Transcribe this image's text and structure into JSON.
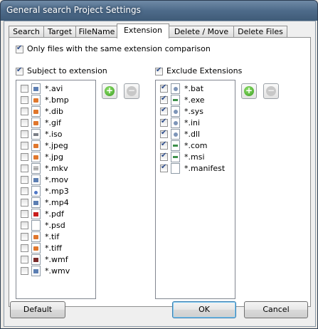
{
  "window": {
    "title": "General search Project Settings"
  },
  "tabs": [
    {
      "label": "Search"
    },
    {
      "label": "Target"
    },
    {
      "label": "FileName"
    },
    {
      "label": "Extension"
    },
    {
      "label": "Delete / Move"
    },
    {
      "label": "Delete Files"
    }
  ],
  "active_tab": "Extension",
  "options": {
    "same_extension_label": "Only files with the same extension comparison",
    "same_extension_checked": true
  },
  "subject": {
    "label": "Subject to extension",
    "checked": true,
    "items": [
      {
        "text": "*.avi",
        "icon": "film-icon"
      },
      {
        "text": "*.bmp",
        "icon": "image-icon"
      },
      {
        "text": "*.dib",
        "icon": "image-icon"
      },
      {
        "text": "*.gif",
        "icon": "image-icon"
      },
      {
        "text": "*.iso",
        "icon": "disc-image-icon"
      },
      {
        "text": "*.jpeg",
        "icon": "image-icon"
      },
      {
        "text": "*.jpg",
        "icon": "image-icon"
      },
      {
        "text": "*.mkv",
        "icon": "document-icon"
      },
      {
        "text": "*.mov",
        "icon": "film-icon"
      },
      {
        "text": "*.mp3",
        "icon": "music-icon"
      },
      {
        "text": "*.mp4",
        "icon": "film-icon"
      },
      {
        "text": "*.pdf",
        "icon": "pdf-icon"
      },
      {
        "text": "*.psd",
        "icon": "blank-file-icon"
      },
      {
        "text": "*.tif",
        "icon": "image-icon"
      },
      {
        "text": "*.tiff",
        "icon": "image-icon"
      },
      {
        "text": "*.wmf",
        "icon": "picture-icon"
      },
      {
        "text": "*.wmv",
        "icon": "film-icon"
      }
    ]
  },
  "exclude": {
    "label": "Exclude Extensions",
    "checked": true,
    "items": [
      {
        "text": "*.bat",
        "icon": "gear-icon",
        "checked": true
      },
      {
        "text": "*.exe",
        "icon": "application-icon",
        "checked": true
      },
      {
        "text": "*.sys",
        "icon": "gear-icon",
        "checked": true
      },
      {
        "text": "*.ini",
        "icon": "gear-icon",
        "checked": true
      },
      {
        "text": "*.dll",
        "icon": "gear-icon",
        "checked": true
      },
      {
        "text": "*.com",
        "icon": "application-icon",
        "checked": true
      },
      {
        "text": "*.msi",
        "icon": "installer-icon",
        "checked": true
      },
      {
        "text": "*.manifest",
        "icon": "blank-file-icon",
        "checked": true
      }
    ]
  },
  "buttons": {
    "add": "+",
    "remove": "−",
    "default": "Default",
    "ok": "OK",
    "cancel": "Cancel"
  }
}
